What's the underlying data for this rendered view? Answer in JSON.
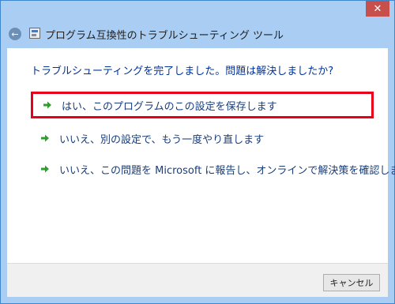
{
  "window": {
    "title": "プログラム互換性のトラブルシューティング ツール",
    "close_glyph": "✕"
  },
  "header": {
    "back_glyph": "←"
  },
  "main": {
    "instruction": "トラブルシューティングを完了しました。問題は解決しましたか?",
    "options": [
      {
        "label": "はい、このプログラムのこの設定を保存します",
        "selected": true
      },
      {
        "label": "いいえ、別の設定で、もう一度やり直します",
        "selected": false
      },
      {
        "label": "いいえ、この問題を Microsoft に報告し、オンラインで解決策を確認します",
        "selected": false
      }
    ]
  },
  "footer": {
    "cancel_label": "キャンセル"
  },
  "colors": {
    "title_bar": "#a9cdf3",
    "close_button": "#c7504c",
    "instruction_text": "#003399",
    "option_text": "#1a3e7a",
    "selection_border": "#e8001a",
    "arrow_green": "#2f9e2f"
  },
  "icons": {
    "back": "back-arrow-icon",
    "app": "app-window-icon",
    "option_arrow": "green-arrow-icon",
    "close": "close-icon"
  }
}
